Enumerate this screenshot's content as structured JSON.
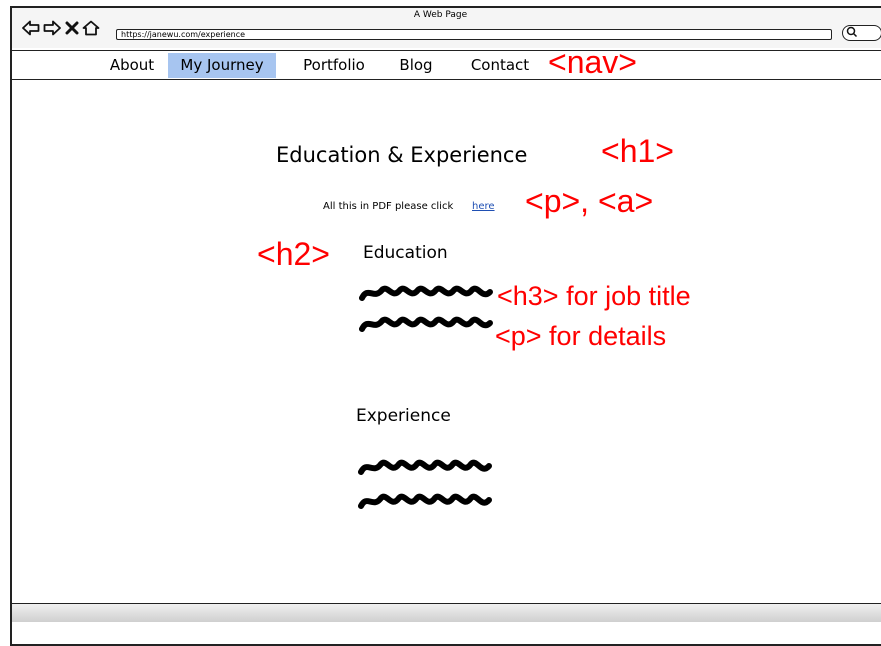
{
  "window": {
    "title": "A Web Page"
  },
  "browser": {
    "back_icon": "back-arrow-icon",
    "forward_icon": "forward-arrow-icon",
    "stop_icon": "close-icon",
    "home_icon": "home-icon",
    "url": "https://janewu.com/experience",
    "search_icon": "search-icon"
  },
  "nav": {
    "items": [
      {
        "label": "About",
        "active": false
      },
      {
        "label": "My Journey",
        "active": true
      },
      {
        "label": "Portfolio",
        "active": false
      },
      {
        "label": "Blog",
        "active": false
      },
      {
        "label": "Contact",
        "active": false
      }
    ],
    "active_color": "#a7c5f0"
  },
  "main": {
    "heading": "Education & Experience",
    "pdf_text": "All this in PDF please click",
    "pdf_link": "here",
    "education_heading": "Education",
    "experience_heading": "Experience"
  },
  "annotations": {
    "nav": "<nav>",
    "h1": "<h1>",
    "p_a": "<p>, <a>",
    "h2": "<h2>",
    "h3": "<h3> for job title",
    "p_details": "<p> for details",
    "color": "#ff0000"
  }
}
